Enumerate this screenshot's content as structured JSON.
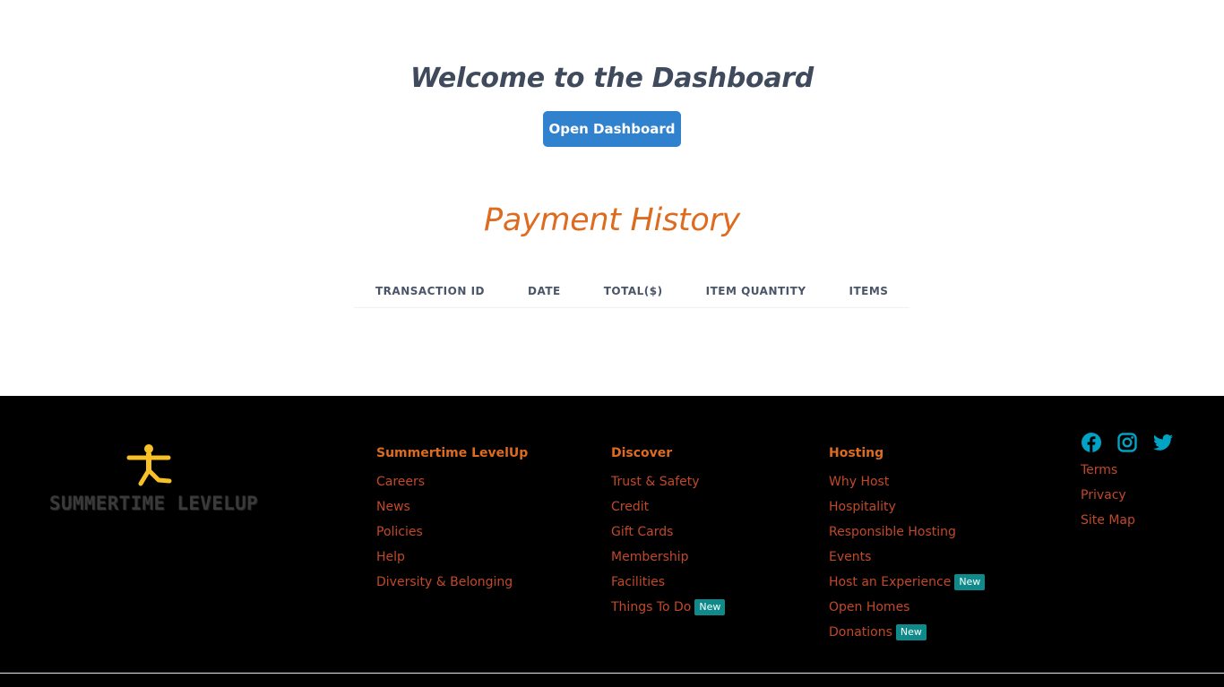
{
  "main": {
    "welcome_title": "Welcome to the Dashboard",
    "open_button_label": "Open Dashboard",
    "payment_title": "Payment History",
    "table": {
      "columns": [
        "TRANSACTION ID",
        "DATE",
        "TOTAL($)",
        "ITEM QUANTITY",
        "ITEMS"
      ],
      "rows": []
    }
  },
  "footer": {
    "logo_text": "SUMMERTIME LEVELUP",
    "columns": [
      {
        "heading": "Summertime LevelUp",
        "links": [
          {
            "label": "Careers"
          },
          {
            "label": "News"
          },
          {
            "label": "Policies"
          },
          {
            "label": "Help"
          },
          {
            "label": "Diversity & Belonging"
          }
        ]
      },
      {
        "heading": "Discover",
        "links": [
          {
            "label": "Trust & Safety"
          },
          {
            "label": "Credit"
          },
          {
            "label": "Gift Cards"
          },
          {
            "label": "Membership"
          },
          {
            "label": "Facilities"
          },
          {
            "label": "Things To Do",
            "badge": "New"
          }
        ]
      },
      {
        "heading": "Hosting",
        "links": [
          {
            "label": "Why Host"
          },
          {
            "label": "Hospitality"
          },
          {
            "label": "Responsible Hosting"
          },
          {
            "label": "Events"
          },
          {
            "label": "Host an Experience",
            "badge": "New"
          },
          {
            "label": "Open Homes"
          },
          {
            "label": "Donations",
            "badge": "New"
          }
        ]
      }
    ],
    "social": [
      "facebook-icon",
      "instagram-icon",
      "twitter-icon"
    ],
    "legal_links": [
      "Terms",
      "Privacy",
      "Site Map"
    ]
  },
  "colors": {
    "primary_button": "#3182ce",
    "accent_orange": "#dd6b20",
    "footer_link": "#c0492a",
    "badge_teal": "#0e8a8a",
    "social_icon": "#00a3c4",
    "logo_figure": "#f6c026"
  }
}
